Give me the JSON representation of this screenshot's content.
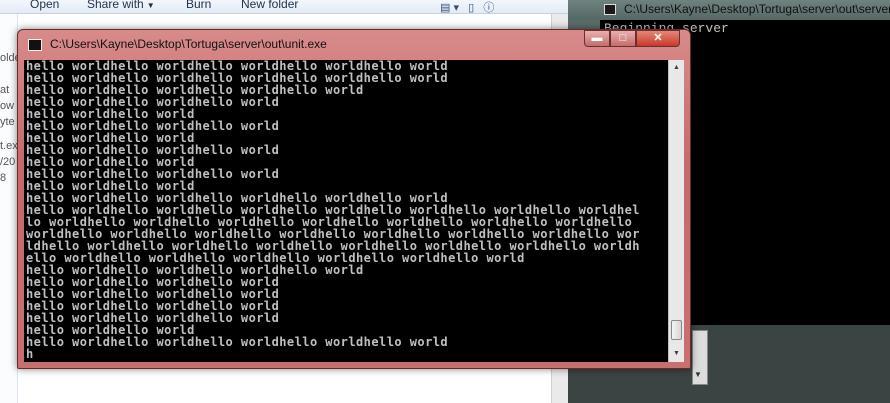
{
  "explorer": {
    "toolbar": {
      "open": "Open",
      "share_with": "Share with",
      "burn": "Burn",
      "new_folder": "New folder"
    },
    "left_fragments": [
      "olde",
      "at",
      "ow",
      "yte",
      "t.ex",
      "/20",
      "8"
    ]
  },
  "server_window": {
    "title": "C:\\Users\\Kayne\\Desktop\\Tortuga\\server\\out\\server.exe",
    "console_lines": [
      "Beginning server"
    ]
  },
  "unit_window": {
    "title": "C:\\Users\\Kayne\\Desktop\\Tortuga\\server\\out\\unit.exe",
    "buttons": {
      "minimize": "▬",
      "maximize": "□",
      "close": "✕"
    },
    "console_lines": [
      "hello worldhello worldhello worldhello worldhello world",
      "hello worldhello worldhello worldhello worldhello world",
      "hello worldhello worldhello worldhello world",
      "hello worldhello worldhello world",
      "hello worldhello world",
      "hello worldhello worldhello world",
      "hello worldhello world",
      "hello worldhello worldhello world",
      "hello worldhello world",
      "hello worldhello worldhello world",
      "hello worldhello world",
      "hello worldhello worldhello worldhello worldhello world",
      "hello worldhello worldhello worldhello worldhello worldhello worldhello worldhel",
      "lo worldhello worldhello worldhello worldhello worldhello worldhello worldhello",
      "worldhello worldhello worldhello worldhello worldhello worldhello worldhello wor",
      "ldhello worldhello worldhello worldhello worldhello worldhello worldhello worldh",
      "ello worldhello worldhello worldhello worldhello worldhello world",
      "hello worldhello worldhello worldhello world",
      "hello worldhello worldhello world",
      "hello worldhello worldhello world",
      "hello worldhello worldhello world",
      "hello worldhello worldhello world",
      "hello worldhello world",
      "hello worldhello worldhello worldhello worldhello world",
      "h"
    ]
  }
}
